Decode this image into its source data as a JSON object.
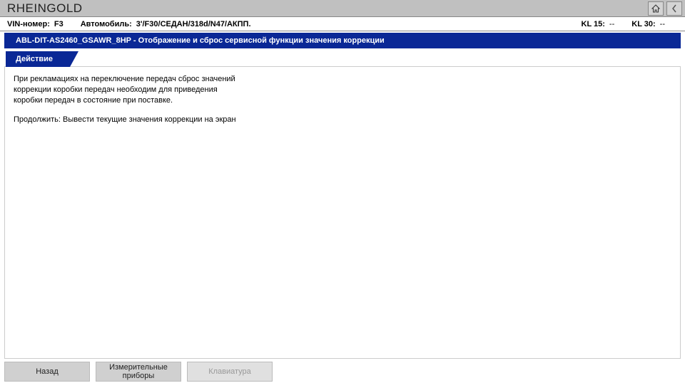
{
  "app": {
    "title": "RHEINGOLD"
  },
  "infobar": {
    "vin_label": "VIN-номер:",
    "vin_value": "F3",
    "vehicle_label": "Автомобиль:",
    "vehicle_value": "3'/F30/СЕДАН/318d/N47/АКПП.",
    "kl15_label": "KL 15:",
    "kl15_value": "--",
    "kl30_label": "KL 30:",
    "kl30_value": "--"
  },
  "bluebar": {
    "text": "ABL-DIT-AS2460_GSAWR_8HP  -  Отображение и сброс сервисной функции значения коррекции"
  },
  "tabs": {
    "action": "Действие"
  },
  "content": {
    "p1": "При рекламациях на переключение передач сброс значений коррекции коробки передач необходим для приведения коробки передач в состояние при поставке.",
    "p2": "Продолжить: Вывести текущие значения коррекции на экран"
  },
  "footer": {
    "back": "Назад",
    "instruments": "Измерительные приборы",
    "keyboard": "Клавиатура"
  }
}
